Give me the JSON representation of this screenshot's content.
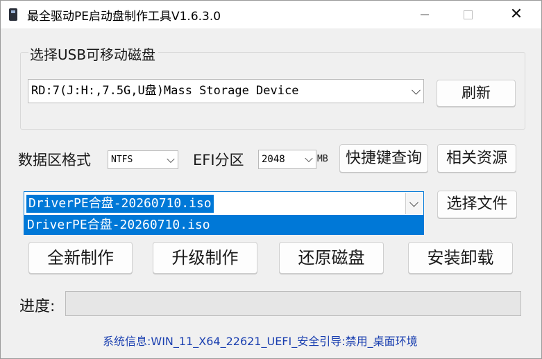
{
  "window": {
    "title": "最全驱动PE启动盘制作工具V1.6.3.0",
    "min_glyph": "",
    "max_glyph": "",
    "close_glyph": "✕"
  },
  "usb_group": {
    "label": "选择USB可移动磁盘",
    "device_value": "RD:7(J:H:,7.5G,U盘)Mass Storage Device",
    "refresh_label": "刷新"
  },
  "format_row": {
    "format_label": "数据区格式",
    "format_value": "NTFS",
    "efi_label": "EFI分区",
    "efi_value": "2048",
    "efi_unit": "MB",
    "hotkey_button": "快捷键查询",
    "resources_button": "相关资源"
  },
  "iso_select": {
    "value": "DriverPE合盘-20260710.iso",
    "dropdown_items": [
      "DriverPE合盘-20260710.iso"
    ],
    "choose_file_button": "选择文件"
  },
  "actions": {
    "new_make": "全新制作",
    "upgrade_make": "升级制作",
    "restore_disk": "还原磁盘",
    "install_uninstall": "安装卸载"
  },
  "progress": {
    "label": "进度:",
    "value": 0
  },
  "status": {
    "system_info": "系统信息:WIN_11_X64_22621_UEFI_安全引导:禁用_桌面环境"
  },
  "colors": {
    "selection": "#0078d7",
    "info_text": "#1a3fb0"
  }
}
